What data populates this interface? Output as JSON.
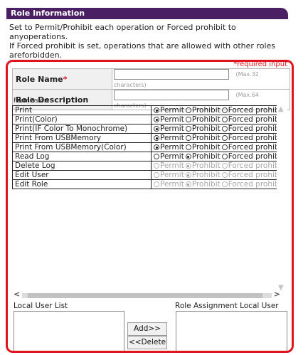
{
  "header": {
    "title": "Role Information"
  },
  "description": [
    "Set to Permit/Prohibit each operation or Forced prohibit to anyoperations.",
    "If Forced prohibit is set, operations that are allowed with other roles",
    "areforbidden."
  ],
  "required_note": "*required input",
  "form": {
    "role_name_label": "Role Name",
    "required_star": "*",
    "role_name_value": "",
    "role_name_hint": "(Max.32 characters)",
    "role_desc_label": "Role Description",
    "role_desc_value": "",
    "role_desc_hint": "(Max.64 characters)"
  },
  "permission": {
    "label": "Permission",
    "options": [
      "Permit",
      "Prohibit",
      "Forced prohibit"
    ],
    "rows": [
      {
        "name": "Print",
        "selected": "Permit",
        "disabled": false
      },
      {
        "name": "Print(Color)",
        "selected": "Permit",
        "disabled": false
      },
      {
        "name": "Print(IF Color To Monochrome)",
        "selected": "Permit",
        "disabled": false
      },
      {
        "name": "Print From USBMemory",
        "selected": "Permit",
        "disabled": false
      },
      {
        "name": "Print From USBMemory(Color)",
        "selected": "Permit",
        "disabled": false
      },
      {
        "name": "Read Log",
        "selected": "Prohibit",
        "disabled": false
      },
      {
        "name": "Delete Log",
        "selected": "Prohibit",
        "disabled": true
      },
      {
        "name": "Edit User",
        "selected": "Prohibit",
        "disabled": true
      },
      {
        "name": "Edit Role",
        "selected": "Prohibit",
        "disabled": true
      }
    ]
  },
  "lists": {
    "local_user_label": "Local User List",
    "assigned_label": "Role Assignment Local User",
    "add_button": "Add>>",
    "delete_button": "<<Delete"
  }
}
